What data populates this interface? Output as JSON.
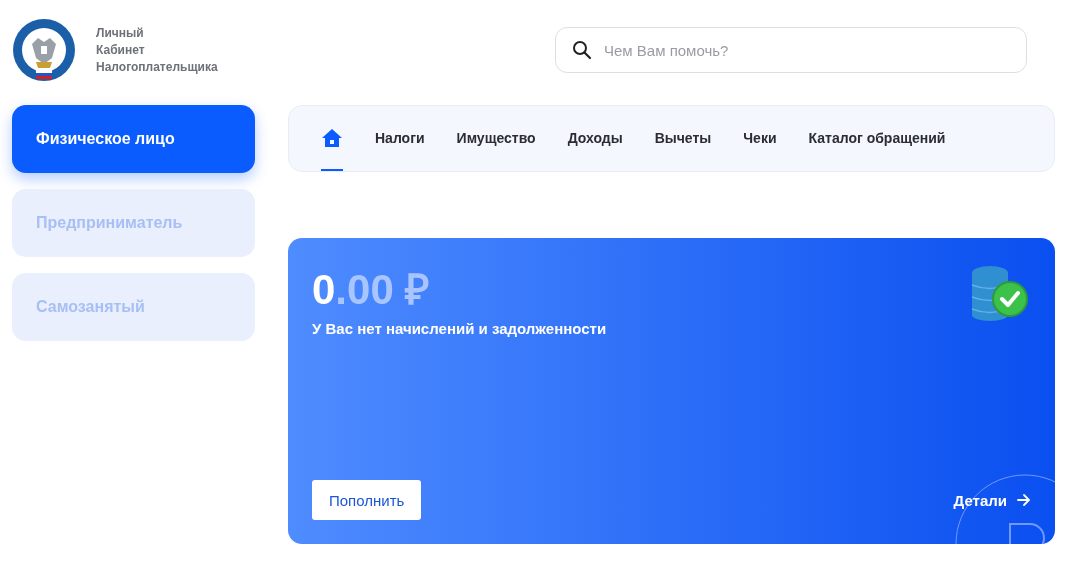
{
  "header": {
    "brand_lines": [
      "Личный",
      "Кабинет",
      "Налогоплательщика"
    ],
    "search": {
      "placeholder": "Чем Вам помочь?"
    }
  },
  "sidebar": {
    "items": [
      {
        "label": "Физическое лицо",
        "selected": true
      },
      {
        "label": "Предприниматель",
        "selected": false
      },
      {
        "label": "Самозанятый",
        "selected": false
      }
    ]
  },
  "nav": {
    "items": [
      {
        "kind": "home",
        "selected": true
      },
      {
        "kind": "text",
        "label": "Налоги",
        "selected": false
      },
      {
        "kind": "text",
        "label": "Имущество",
        "selected": false
      },
      {
        "kind": "text",
        "label": "Доходы",
        "selected": false
      },
      {
        "kind": "text",
        "label": "Вычеты",
        "selected": false
      },
      {
        "kind": "text",
        "label": "Чеки",
        "selected": false
      },
      {
        "kind": "text",
        "label": "Каталог обращений",
        "selected": false
      }
    ]
  },
  "balance_card": {
    "amount_whole": "0",
    "amount_rest": ".00 ₽",
    "message": "У Вас нет начислений и задолженности",
    "top_up_button": "Пополнить",
    "details_link": "Детали"
  }
}
